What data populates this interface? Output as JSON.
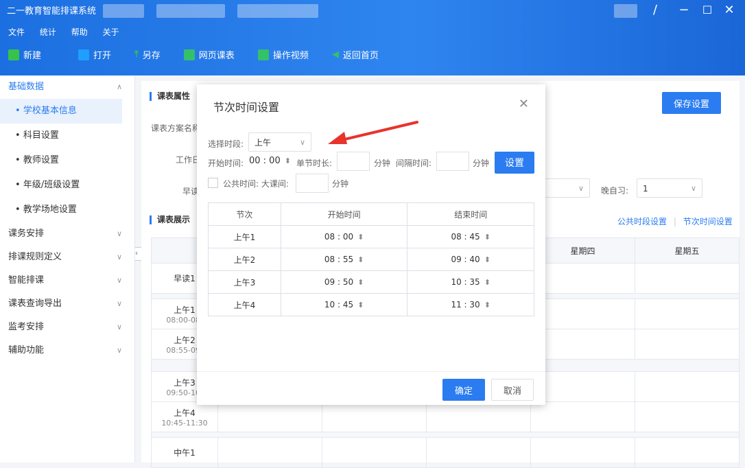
{
  "app": {
    "title": "二一教育智能排课系统"
  },
  "menu": [
    "文件",
    "统计",
    "帮助",
    "关于"
  ],
  "toolbar": [
    {
      "label": "新建",
      "icon": "new-file-icon",
      "color": "#37c24c"
    },
    {
      "label": "打开",
      "icon": "folder-icon",
      "color": "#1f9fff"
    },
    {
      "label": "另存",
      "icon": "save-as-icon",
      "color": "#37c24c"
    },
    {
      "label": "网页课表",
      "icon": "web-table-icon",
      "color": "#35c06a"
    },
    {
      "label": "操作视频",
      "icon": "video-icon",
      "color": "#35c06a"
    },
    {
      "label": "返回首页",
      "icon": "back-home-icon",
      "color": "#35c06a"
    }
  ],
  "sidebar": {
    "group1": {
      "label": "基础数据"
    },
    "subitems": [
      "学校基本信息",
      "科目设置",
      "教师设置",
      "年级/班级设置",
      "教学场地设置"
    ],
    "groups": [
      "课务安排",
      "排课规则定义",
      "智能排课",
      "课表查询导出",
      "监考安排",
      "辅助功能"
    ]
  },
  "main": {
    "section_props": "课表属性",
    "save_label": "保存设置",
    "scheme_label": "课表方案名称",
    "workday_label": "工作日",
    "early_label": "早读",
    "evening_label": "晚自习:",
    "evening_value": "1",
    "section_display": "课表展示",
    "link_public": "公共时段设置",
    "link_period": "节次时间设置",
    "days": [
      "星期四",
      "星期五"
    ],
    "rows": [
      {
        "name": "早读1",
        "time": ""
      },
      {
        "name": "上午1",
        "time": "08:00-08:"
      },
      {
        "name": "上午2",
        "time": "08:55-09:"
      },
      {
        "name": "上午3",
        "time": "09:50-10:"
      },
      {
        "name": "上午4",
        "time": "10:45-11:30"
      },
      {
        "name": "中午1",
        "time": ""
      }
    ]
  },
  "dialog": {
    "title": "节次时间设置",
    "period_label": "选择时段:",
    "period_value": "上午",
    "start_label": "开始时间:",
    "start_value": "00 : 00",
    "unit_len_label": "单节时长:",
    "unit_min": "分钟",
    "gap_label": "间隔时间:",
    "gap_min": "分钟",
    "set_label": "设置",
    "public_label": "公共时间: 大课间:",
    "public_min": "分钟",
    "col_period": "节次",
    "col_start": "开始时间",
    "col_end": "结束时间",
    "rows": [
      {
        "name": "上午1",
        "start": "08 : 00",
        "end": "08 : 45"
      },
      {
        "name": "上午2",
        "start": "08 : 55",
        "end": "09 : 40"
      },
      {
        "name": "上午3",
        "start": "09 : 50",
        "end": "10 : 35"
      },
      {
        "name": "上午4",
        "start": "10 : 45",
        "end": "11 : 30"
      }
    ],
    "ok_label": "确定",
    "cancel_label": "取消"
  },
  "colors": {
    "accent": "#2a7cf0",
    "header": "#2177e8",
    "arrow": "#e8332c"
  }
}
